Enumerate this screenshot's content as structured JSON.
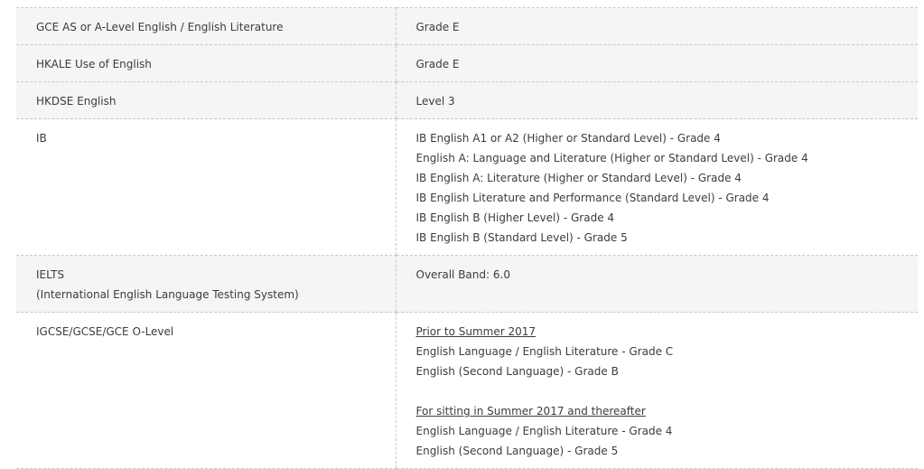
{
  "rows": [
    {
      "qualification": [
        "GCE AS or A-Level English / English Literature"
      ],
      "requirement": [
        "Grade E"
      ]
    },
    {
      "qualification": [
        "HKALE Use of English"
      ],
      "requirement": [
        "Grade E"
      ]
    },
    {
      "qualification": [
        "HKDSE English"
      ],
      "requirement": [
        "Level 3"
      ]
    },
    {
      "qualification": [
        "IB"
      ],
      "requirement": [
        "IB English A1 or A2 (Higher or Standard Level) - Grade 4",
        "English A: Language and Literature (Higher or Standard Level) - Grade 4",
        "IB English A: Literature (Higher or Standard Level) - Grade 4",
        "IB English Literature and Performance (Standard Level) - Grade 4",
        "IB English B (Higher Level) - Grade 4",
        "IB English B (Standard Level) - Grade 5"
      ]
    },
    {
      "qualification": [
        "IELTS",
        "(International English Language Testing System)"
      ],
      "requirement": [
        "Overall Band: 6.0"
      ]
    },
    {
      "qualification": [
        "IGCSE/GCSE/GCE O-Level"
      ],
      "requirement_groups": [
        {
          "heading": "Prior to Summer 2017",
          "lines": [
            "English Language / English Literature - Grade C",
            "English (Second Language) - Grade B"
          ]
        },
        {
          "heading": "For sitting in Summer 2017 and thereafter",
          "lines": [
            "English Language / English Literature - Grade 4",
            "English (Second Language) - Grade 5"
          ]
        }
      ]
    }
  ]
}
